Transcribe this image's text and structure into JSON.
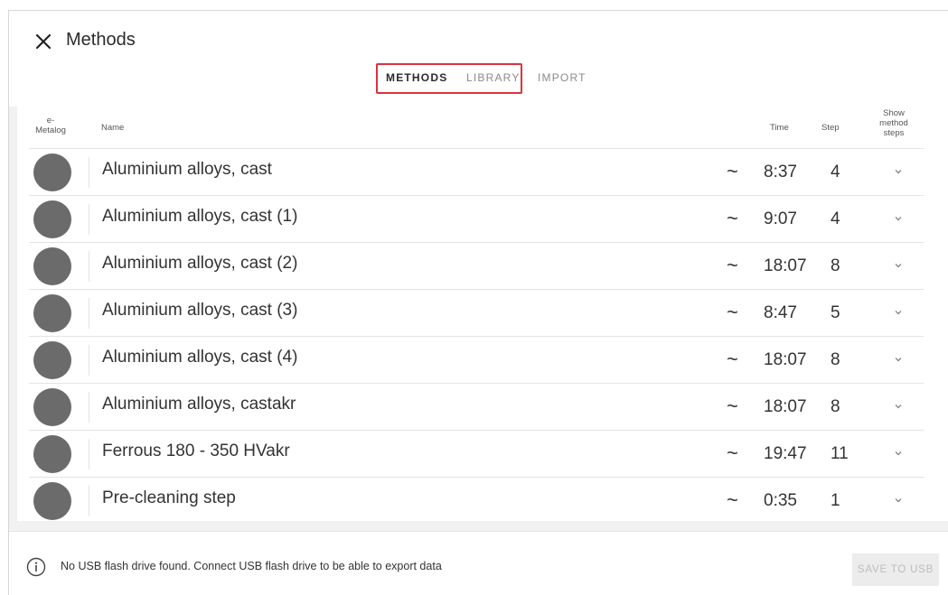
{
  "header": {
    "title": "Methods",
    "tabs": [
      {
        "label": "METHODS",
        "active": true
      },
      {
        "label": "LIBRARY",
        "active": false
      },
      {
        "label": "IMPORT",
        "active": false
      }
    ]
  },
  "table": {
    "columns": {
      "emetalog_line1": "e-",
      "emetalog_line2": "Metalog",
      "name": "Name",
      "time": "Time",
      "step": "Step",
      "show_line1": "Show",
      "show_line2": "method",
      "show_line3": "steps"
    },
    "rows": [
      {
        "name": "Aluminium alloys, cast",
        "approx": "~",
        "time": "8:37",
        "step": "4"
      },
      {
        "name": "Aluminium alloys, cast (1)",
        "approx": "~",
        "time": "9:07",
        "step": "4"
      },
      {
        "name": "Aluminium alloys, cast (2)",
        "approx": "~",
        "time": "18:07",
        "step": "8"
      },
      {
        "name": "Aluminium alloys, cast (3)",
        "approx": "~",
        "time": "8:47",
        "step": "5"
      },
      {
        "name": "Aluminium alloys, cast (4)",
        "approx": "~",
        "time": "18:07",
        "step": "8"
      },
      {
        "name": "Aluminium alloys, castakr",
        "approx": "~",
        "time": "18:07",
        "step": "8"
      },
      {
        "name": "Ferrous 180 - 350 HVakr",
        "approx": "~",
        "time": "19:47",
        "step": "11"
      },
      {
        "name": "Pre-cleaning step",
        "approx": "~",
        "time": "0:35",
        "step": "1"
      }
    ]
  },
  "footer": {
    "message": "No USB flash drive found. Connect USB flash drive to be able to export data",
    "save_label": "SAVE TO USB"
  },
  "colors": {
    "highlight_box": "#d9333f",
    "avatar": "#6b6b6b",
    "background_band": "#f1f1f1"
  },
  "icons": {
    "close": "close-icon",
    "chevron": "chevron-down-icon",
    "info": "info-icon"
  }
}
